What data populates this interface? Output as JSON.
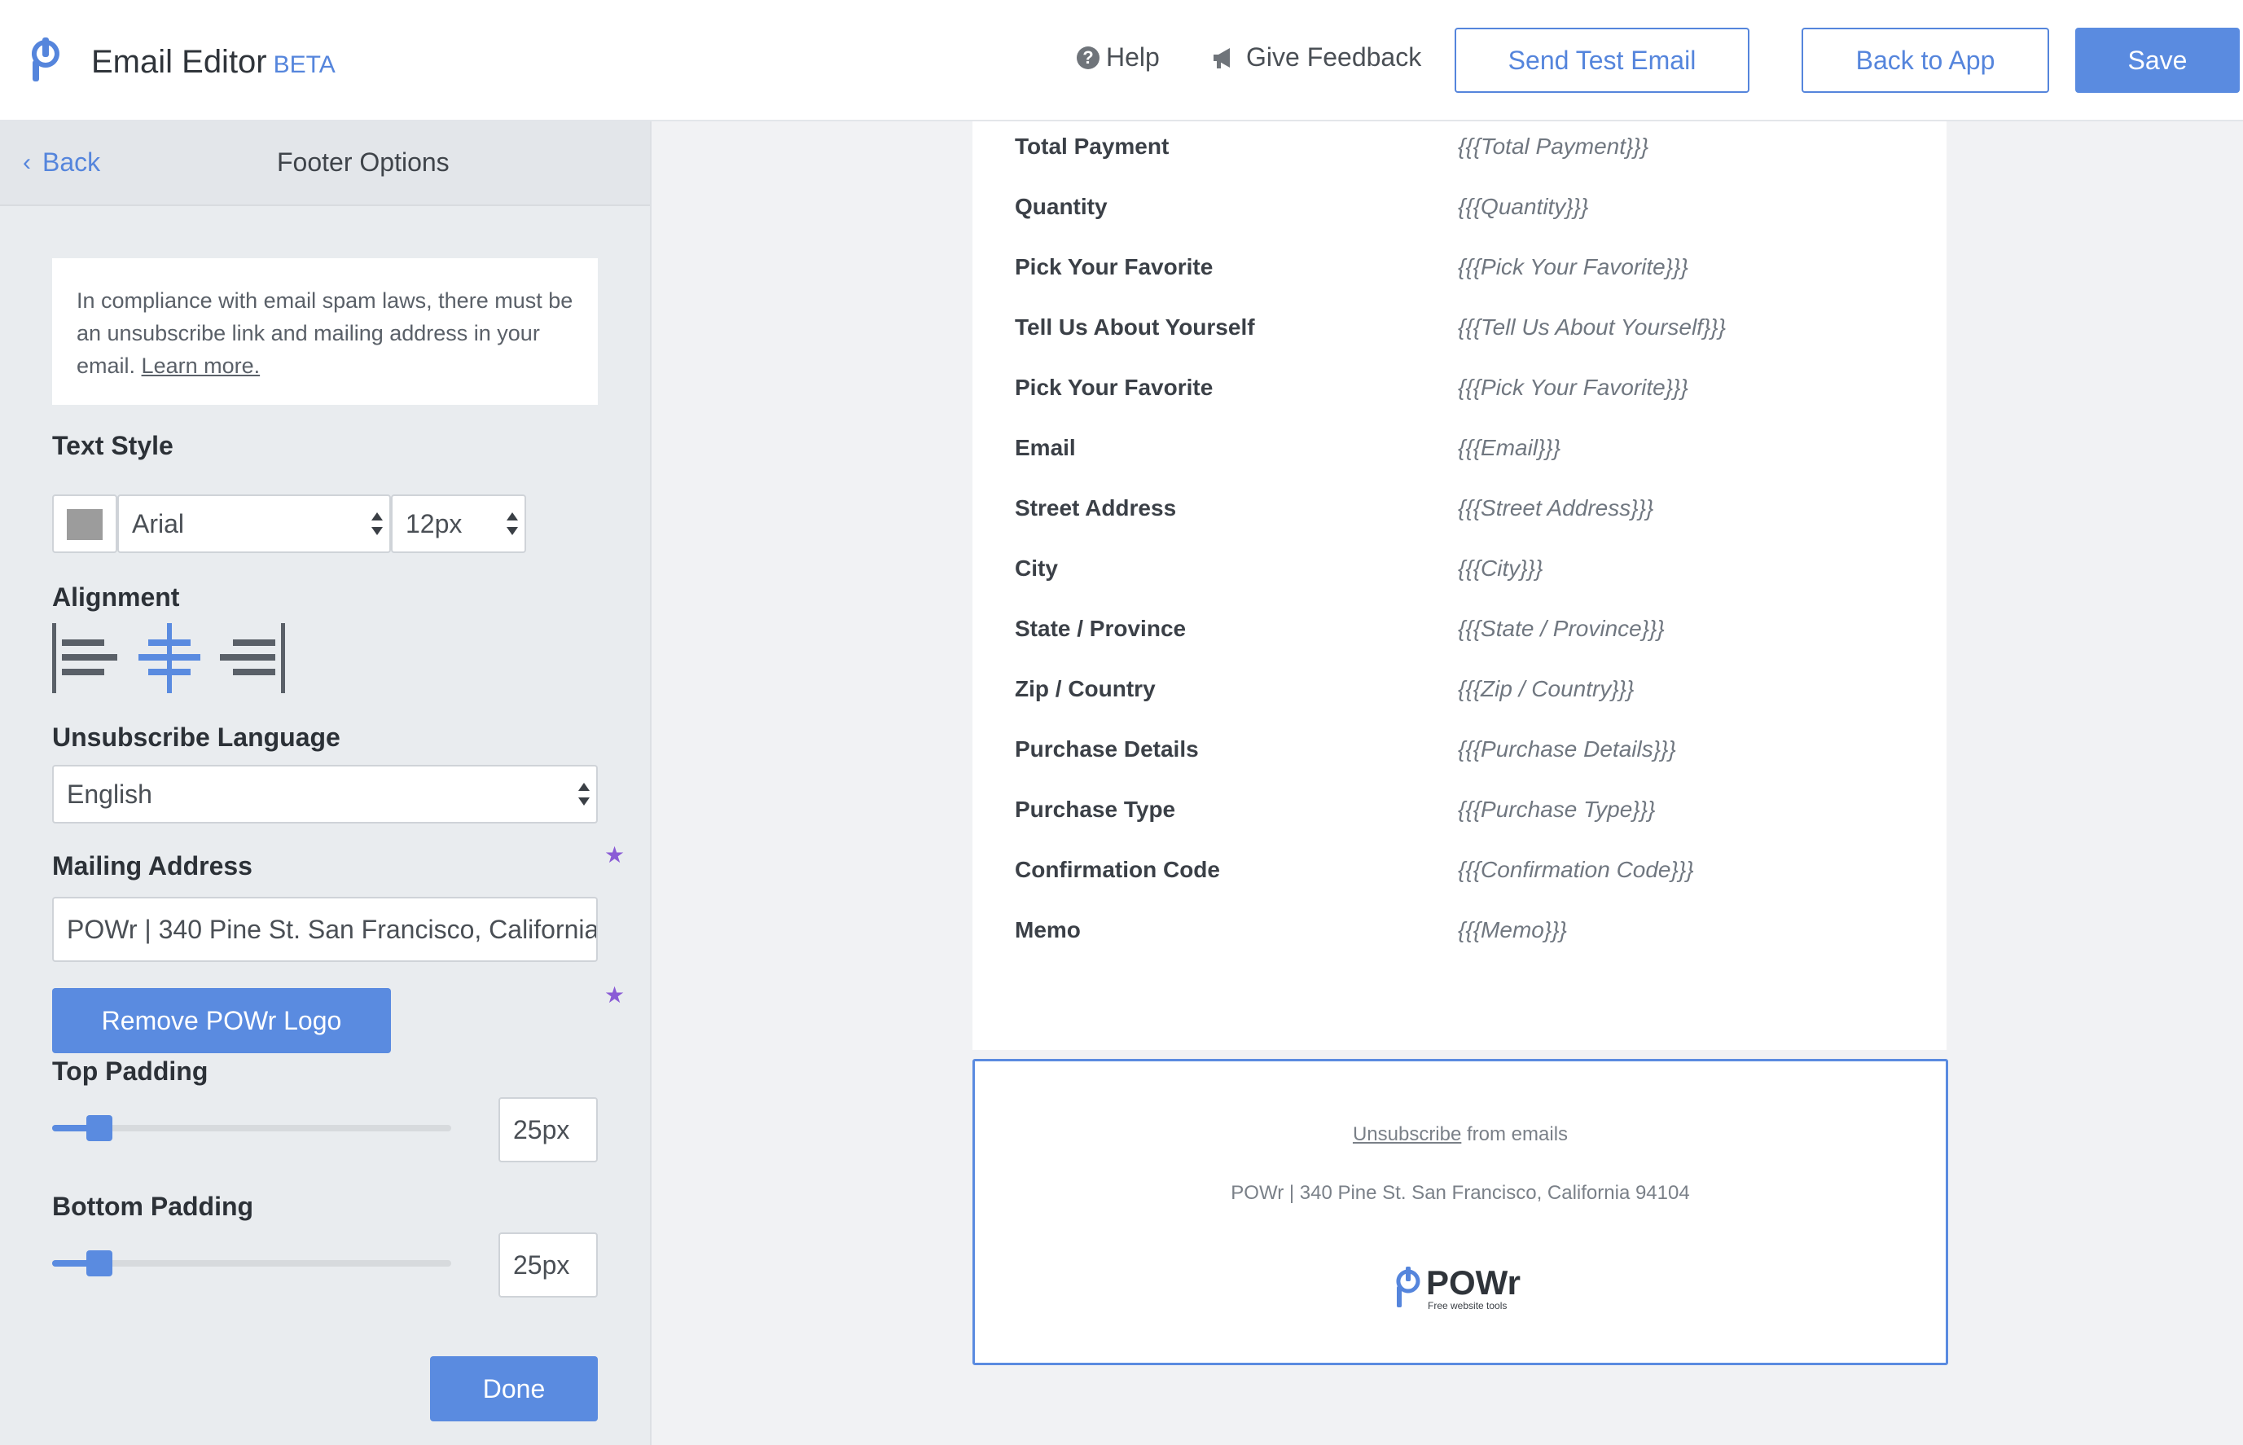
{
  "header": {
    "title": "Email Editor",
    "beta": "BETA",
    "help": "Help",
    "feedback": "Give Feedback",
    "send_test": "Send Test Email",
    "back_to_app": "Back to App",
    "save": "Save"
  },
  "panel": {
    "back": "Back",
    "title": "Footer Options",
    "notice": "In compliance with email spam laws, there must be an unsubscribe link and mailing address in your email.",
    "learn_more": "Learn more.",
    "text_style_label": "Text Style",
    "text_color": "#9c9c9c",
    "font": "Arial",
    "font_size": "12px",
    "alignment_label": "Alignment",
    "alignment_selected": "center",
    "unsubscribe_label": "Unsubscribe Language",
    "unsubscribe_language": "English",
    "mailing_label": "Mailing Address",
    "mailing_address": "POWr | 340 Pine St. San Francisco, California 94104",
    "remove_logo": "Remove POWr Logo",
    "top_padding_label": "Top Padding",
    "top_padding": "25px",
    "bottom_padding_label": "Bottom Padding",
    "bottom_padding": "25px",
    "done": "Done"
  },
  "preview": {
    "rows": [
      {
        "label": "Total Payment",
        "value": "{{{Total Payment}}}"
      },
      {
        "label": "Quantity",
        "value": "{{{Quantity}}}"
      },
      {
        "label": "Pick Your Favorite",
        "value": "{{{Pick Your Favorite}}}"
      },
      {
        "label": "Tell Us About Yourself",
        "value": "{{{Tell Us About Yourself}}}"
      },
      {
        "label": "Pick Your Favorite",
        "value": "{{{Pick Your Favorite}}}"
      },
      {
        "label": "Email",
        "value": "{{{Email}}}"
      },
      {
        "label": "Street Address",
        "value": "{{{Street Address}}}"
      },
      {
        "label": "City",
        "value": "{{{City}}}"
      },
      {
        "label": "State / Province",
        "value": "{{{State / Province}}}"
      },
      {
        "label": "Zip / Country",
        "value": "{{{Zip / Country}}}"
      },
      {
        "label": "Purchase Details",
        "value": "{{{Purchase Details}}}"
      },
      {
        "label": "Purchase Type",
        "value": "{{{Purchase Type}}}"
      },
      {
        "label": "Confirmation Code",
        "value": "{{{Confirmation Code}}}"
      },
      {
        "label": "Memo",
        "value": "{{{Memo}}}"
      }
    ],
    "footer": {
      "unsubscribe_link": "Unsubscribe",
      "unsubscribe_rest": "from emails",
      "address": "POWr | 340 Pine St. San Francisco, California 94104",
      "logo_text": "POWr",
      "logo_tagline": "Free website tools"
    }
  },
  "colors": {
    "accent": "#5a8be0",
    "star": "#8a5bd6"
  }
}
